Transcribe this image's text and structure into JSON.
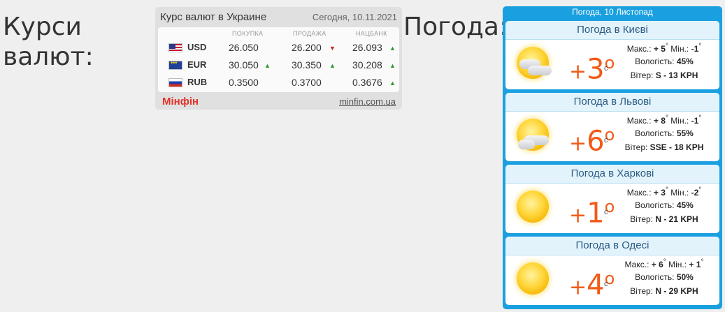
{
  "headings": {
    "rates": "Курси валют:",
    "weather": "Погода:"
  },
  "currency": {
    "title": "Курс валют в Украине",
    "date": "Сегодня, 10.11.2021",
    "columns": [
      "ПОКУПКА",
      "ПРОДАЖА",
      "НАЦБАНК"
    ],
    "rows": [
      {
        "code": "USD",
        "flag": "us-flag-icon",
        "buy": "26.050",
        "buy_trend": "",
        "sell": "26.200",
        "sell_trend": "down",
        "nbu": "26.093",
        "nbu_trend": "up"
      },
      {
        "code": "EUR",
        "flag": "eu-flag-icon",
        "buy": "30.050",
        "buy_trend": "up",
        "sell": "30.350",
        "sell_trend": "up",
        "nbu": "30.208",
        "nbu_trend": "up"
      },
      {
        "code": "RUB",
        "flag": "ru-flag-icon",
        "buy": "0.3500",
        "buy_trend": "",
        "sell": "0.3700",
        "sell_trend": "",
        "nbu": "0.3676",
        "nbu_trend": "up"
      }
    ],
    "brand": "Мінфін",
    "link": "minfin.com.ua",
    "colors": {
      "up": "#2b9b2b",
      "down": "#d02020",
      "brand": "#e0322a"
    }
  },
  "weather": {
    "title": "Погода, 10 Листопад",
    "labels": {
      "max": "Макс.:",
      "min": "Мін.:",
      "humidity": "Вологість:",
      "wind": "Вітер:",
      "unit": "c",
      "degree": "°"
    },
    "cities": [
      {
        "name": "Погода в Києві",
        "temp": "+3",
        "max": "+ 5",
        "min": "-1",
        "humidity": "45%",
        "wind": "S - 13 KPH",
        "icon": "partly-cloudy-icon"
      },
      {
        "name": "Погода в Львові",
        "temp": "+6",
        "max": "+ 8",
        "min": "-1",
        "humidity": "55%",
        "wind": "SSE - 18 KPH",
        "icon": "partly-cloudy-icon"
      },
      {
        "name": "Погода в Харкові",
        "temp": "+1",
        "max": "+ 3",
        "min": "-2",
        "humidity": "45%",
        "wind": "N - 21 KPH",
        "icon": "sun-icon"
      },
      {
        "name": "Погода в Одесі",
        "temp": "+4",
        "max": "+ 6",
        "min": "+ 1",
        "humidity": "50%",
        "wind": "N - 29 KPH",
        "icon": "sun-icon"
      }
    ],
    "colors": {
      "accent": "#1aa0e0",
      "temp": "#f25a17",
      "city_title": "#2a5a84"
    }
  }
}
